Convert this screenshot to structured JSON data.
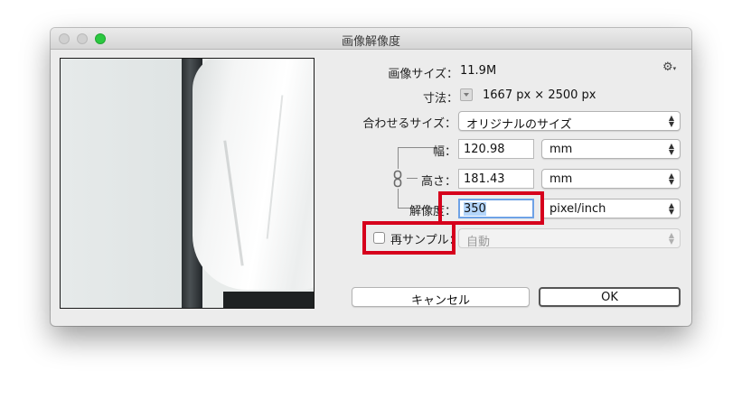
{
  "window": {
    "title": "画像解像度"
  },
  "image_size": {
    "label": "画像サイズ：",
    "value": "11.9M"
  },
  "dimensions": {
    "label": "寸法：",
    "value": "1667 px × 2500 px"
  },
  "fit_to": {
    "label": "合わせるサイズ：",
    "value": "オリジナルのサイズ"
  },
  "width": {
    "label": "幅：",
    "value": "120.98",
    "unit": "mm"
  },
  "height": {
    "label": "高さ：",
    "value": "181.43",
    "unit": "mm"
  },
  "resolution": {
    "label": "解像度：",
    "value": "350",
    "unit": "pixel/inch"
  },
  "resample": {
    "label": "再サンプル：",
    "checked": false,
    "method": "自動"
  },
  "buttons": {
    "cancel": "キャンセル",
    "ok": "OK"
  },
  "icons": {
    "settings": "gear-icon",
    "chain": "chain-link-icon"
  },
  "colors": {
    "highlight": "#d6001c",
    "selection": "#b4d6fb"
  }
}
